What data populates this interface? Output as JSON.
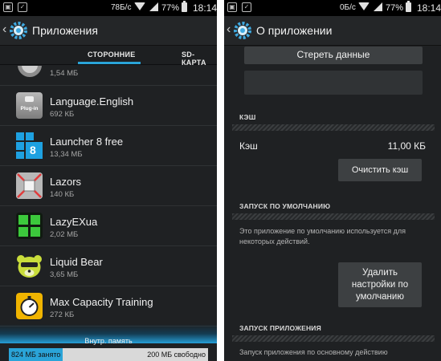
{
  "left_screen": {
    "status": {
      "speed": "78Б/с",
      "battery": "77%",
      "time": "18:14"
    },
    "action_bar": {
      "title": "Приложения"
    },
    "tabs": [
      {
        "label": "СТОРОННИЕ",
        "active": true
      },
      {
        "label": "SD-КАРТА",
        "active": false
      }
    ],
    "apps": [
      {
        "name": "",
        "size": "1,54 МБ",
        "icon": "partial-app-icon"
      },
      {
        "name": "Language.English",
        "size": "692 КБ",
        "icon": "plugin-icon",
        "badge": "Plug-in"
      },
      {
        "name": "Launcher 8 free",
        "size": "13,34 МБ",
        "icon": "launcher-tiles-icon",
        "badge": "8"
      },
      {
        "name": "Lazors",
        "size": "140 КБ",
        "icon": "lazors-icon"
      },
      {
        "name": "LazyEXua",
        "size": "2,02 МБ",
        "icon": "lazyex-icon"
      },
      {
        "name": "Liquid Bear",
        "size": "3,65 МБ",
        "icon": "bear-icon"
      },
      {
        "name": "Max Capacity Training",
        "size": "272 КБ",
        "icon": "stopwatch-icon"
      }
    ],
    "storage": {
      "label": "Внутр. память",
      "used": "824 МБ занято",
      "free": "200 МБ свободно",
      "used_fraction": 0.27
    }
  },
  "right_screen": {
    "status": {
      "speed": "0Б/с",
      "battery": "77%",
      "time": "18:14"
    },
    "action_bar": {
      "title": "О приложении"
    },
    "clear_data_button": "Стереть данные",
    "cache_section": {
      "header": "КЭШ",
      "label": "Кэш",
      "value": "11,00 КБ",
      "clear_button": "Очистить кэш"
    },
    "defaults_section": {
      "header": "ЗАПУСК ПО УМОЛЧАНИЮ",
      "description": "Это приложение по умолчанию используется для некоторых действий.",
      "button": "Удалить настройки по умолчанию"
    },
    "launch_section": {
      "header": "ЗАПУСК ПРИЛОЖЕНИЯ",
      "description": "Запуск приложения по основному действию"
    }
  },
  "colors": {
    "accent": "#2aa4d8",
    "background": "#1f2123",
    "button": "#3d4042"
  }
}
